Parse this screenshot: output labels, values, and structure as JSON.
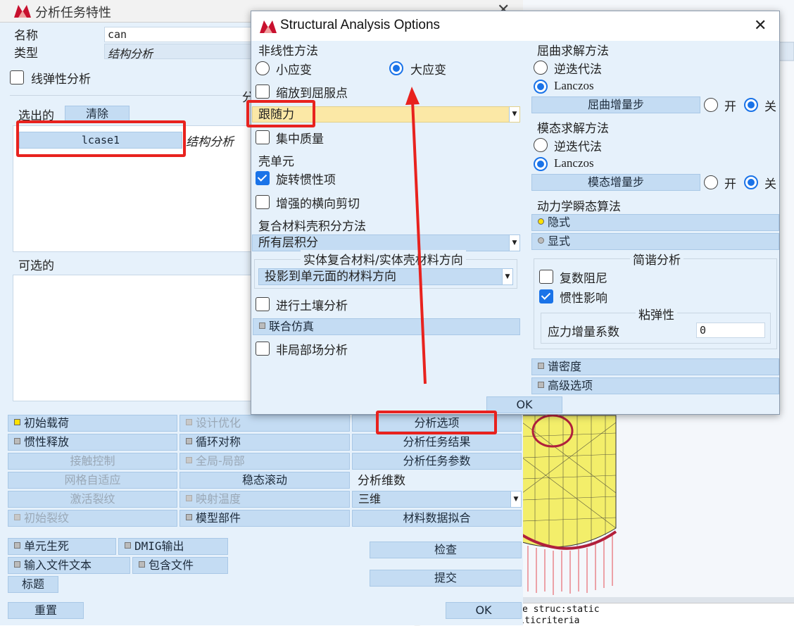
{
  "background": {
    "command_lines": [
      "e struc:static",
      "Command > *loadcase_option stepping:multicriteria"
    ]
  },
  "task_window": {
    "title": "分析任务特性",
    "name_label": "名称",
    "name_value": "can",
    "type_label": "类型",
    "type_value": "结构分析",
    "linear_elastic_label": "线弹性分析",
    "partial_heading": "分",
    "selected_label": "选出的",
    "clear_button": "清除",
    "selected_item": "lcase1",
    "selected_item_type": "结构分析",
    "available_label": "可选的",
    "grid_buttons": [
      [
        "初始载荷",
        "设计优化",
        "分析选项"
      ],
      [
        "惯性释放",
        "循环对称",
        "分析任务结果"
      ],
      [
        "接触控制",
        "全局-局部",
        "分析任务参数"
      ],
      [
        "网格自适应",
        "稳态滚动"
      ],
      [
        "激活裂纹",
        "映射温度"
      ],
      [
        "初始裂纹",
        "模型部件",
        "材料数据拟合"
      ]
    ],
    "dimension_label": "分析维数",
    "dimension_value": "三维",
    "element_birth_death": "单元生死",
    "dmig_output": "DMIG输出",
    "input_file_text": "输入文件文本",
    "include_file": "包含文件",
    "title_button": "标题",
    "check_button": "检查",
    "submit_button": "提交",
    "reset_button": "重置",
    "ok_button": "OK"
  },
  "dialog": {
    "title": "Structural Analysis Options",
    "nonlinear_heading": "非线性方法",
    "small_strain": "小应变",
    "large_strain": "大应变",
    "scale_to_yield": "缩放到屈服点",
    "follower_force": "跟随力",
    "lumped_mass": "集中质量",
    "shell_heading": "壳单元",
    "rotary_inertia": "旋转惯性项",
    "enhanced_shear": "增强的横向剪切",
    "composite_heading": "复合材料壳积分方法",
    "composite_value": "所有层积分",
    "solid_composite_heading": "实体复合材料/实体壳材料方向",
    "solid_composite_value": "投影到单元面的材料方向",
    "soil_analysis": "进行土壤分析",
    "cosimulation": "联合仿真",
    "nonlocal": "非局部场分析",
    "buckling_heading": "屈曲求解方法",
    "inverse_iteration": "逆迭代法",
    "lanczos": "Lanczos",
    "buckling_increment": "屈曲增量步",
    "on": "开",
    "off": "关",
    "modal_heading": "模态求解方法",
    "modal_inverse": "逆迭代法",
    "modal_lanczos": "Lanczos",
    "modal_increment": "模态增量步",
    "transient_heading": "动力学瞬态算法",
    "implicit": "隐式",
    "explicit": "显式",
    "harmonic_heading": "简谐分析",
    "complex_damping": "复数阻尼",
    "inertia_effects": "惯性影响",
    "viscoelastic_heading": "粘弹性",
    "stress_increment_label": "应力增量系数",
    "stress_increment_value": "0",
    "spectral_density": "谱密度",
    "advanced_options": "高级选项",
    "ok_button": "OK"
  },
  "colors": {
    "panel": "#e6f1fb",
    "button": "#c4dcf3",
    "highlight_bar": "#fbe8a6",
    "red_annotation": "#e8221e",
    "accent_blue": "#1a73e8"
  }
}
